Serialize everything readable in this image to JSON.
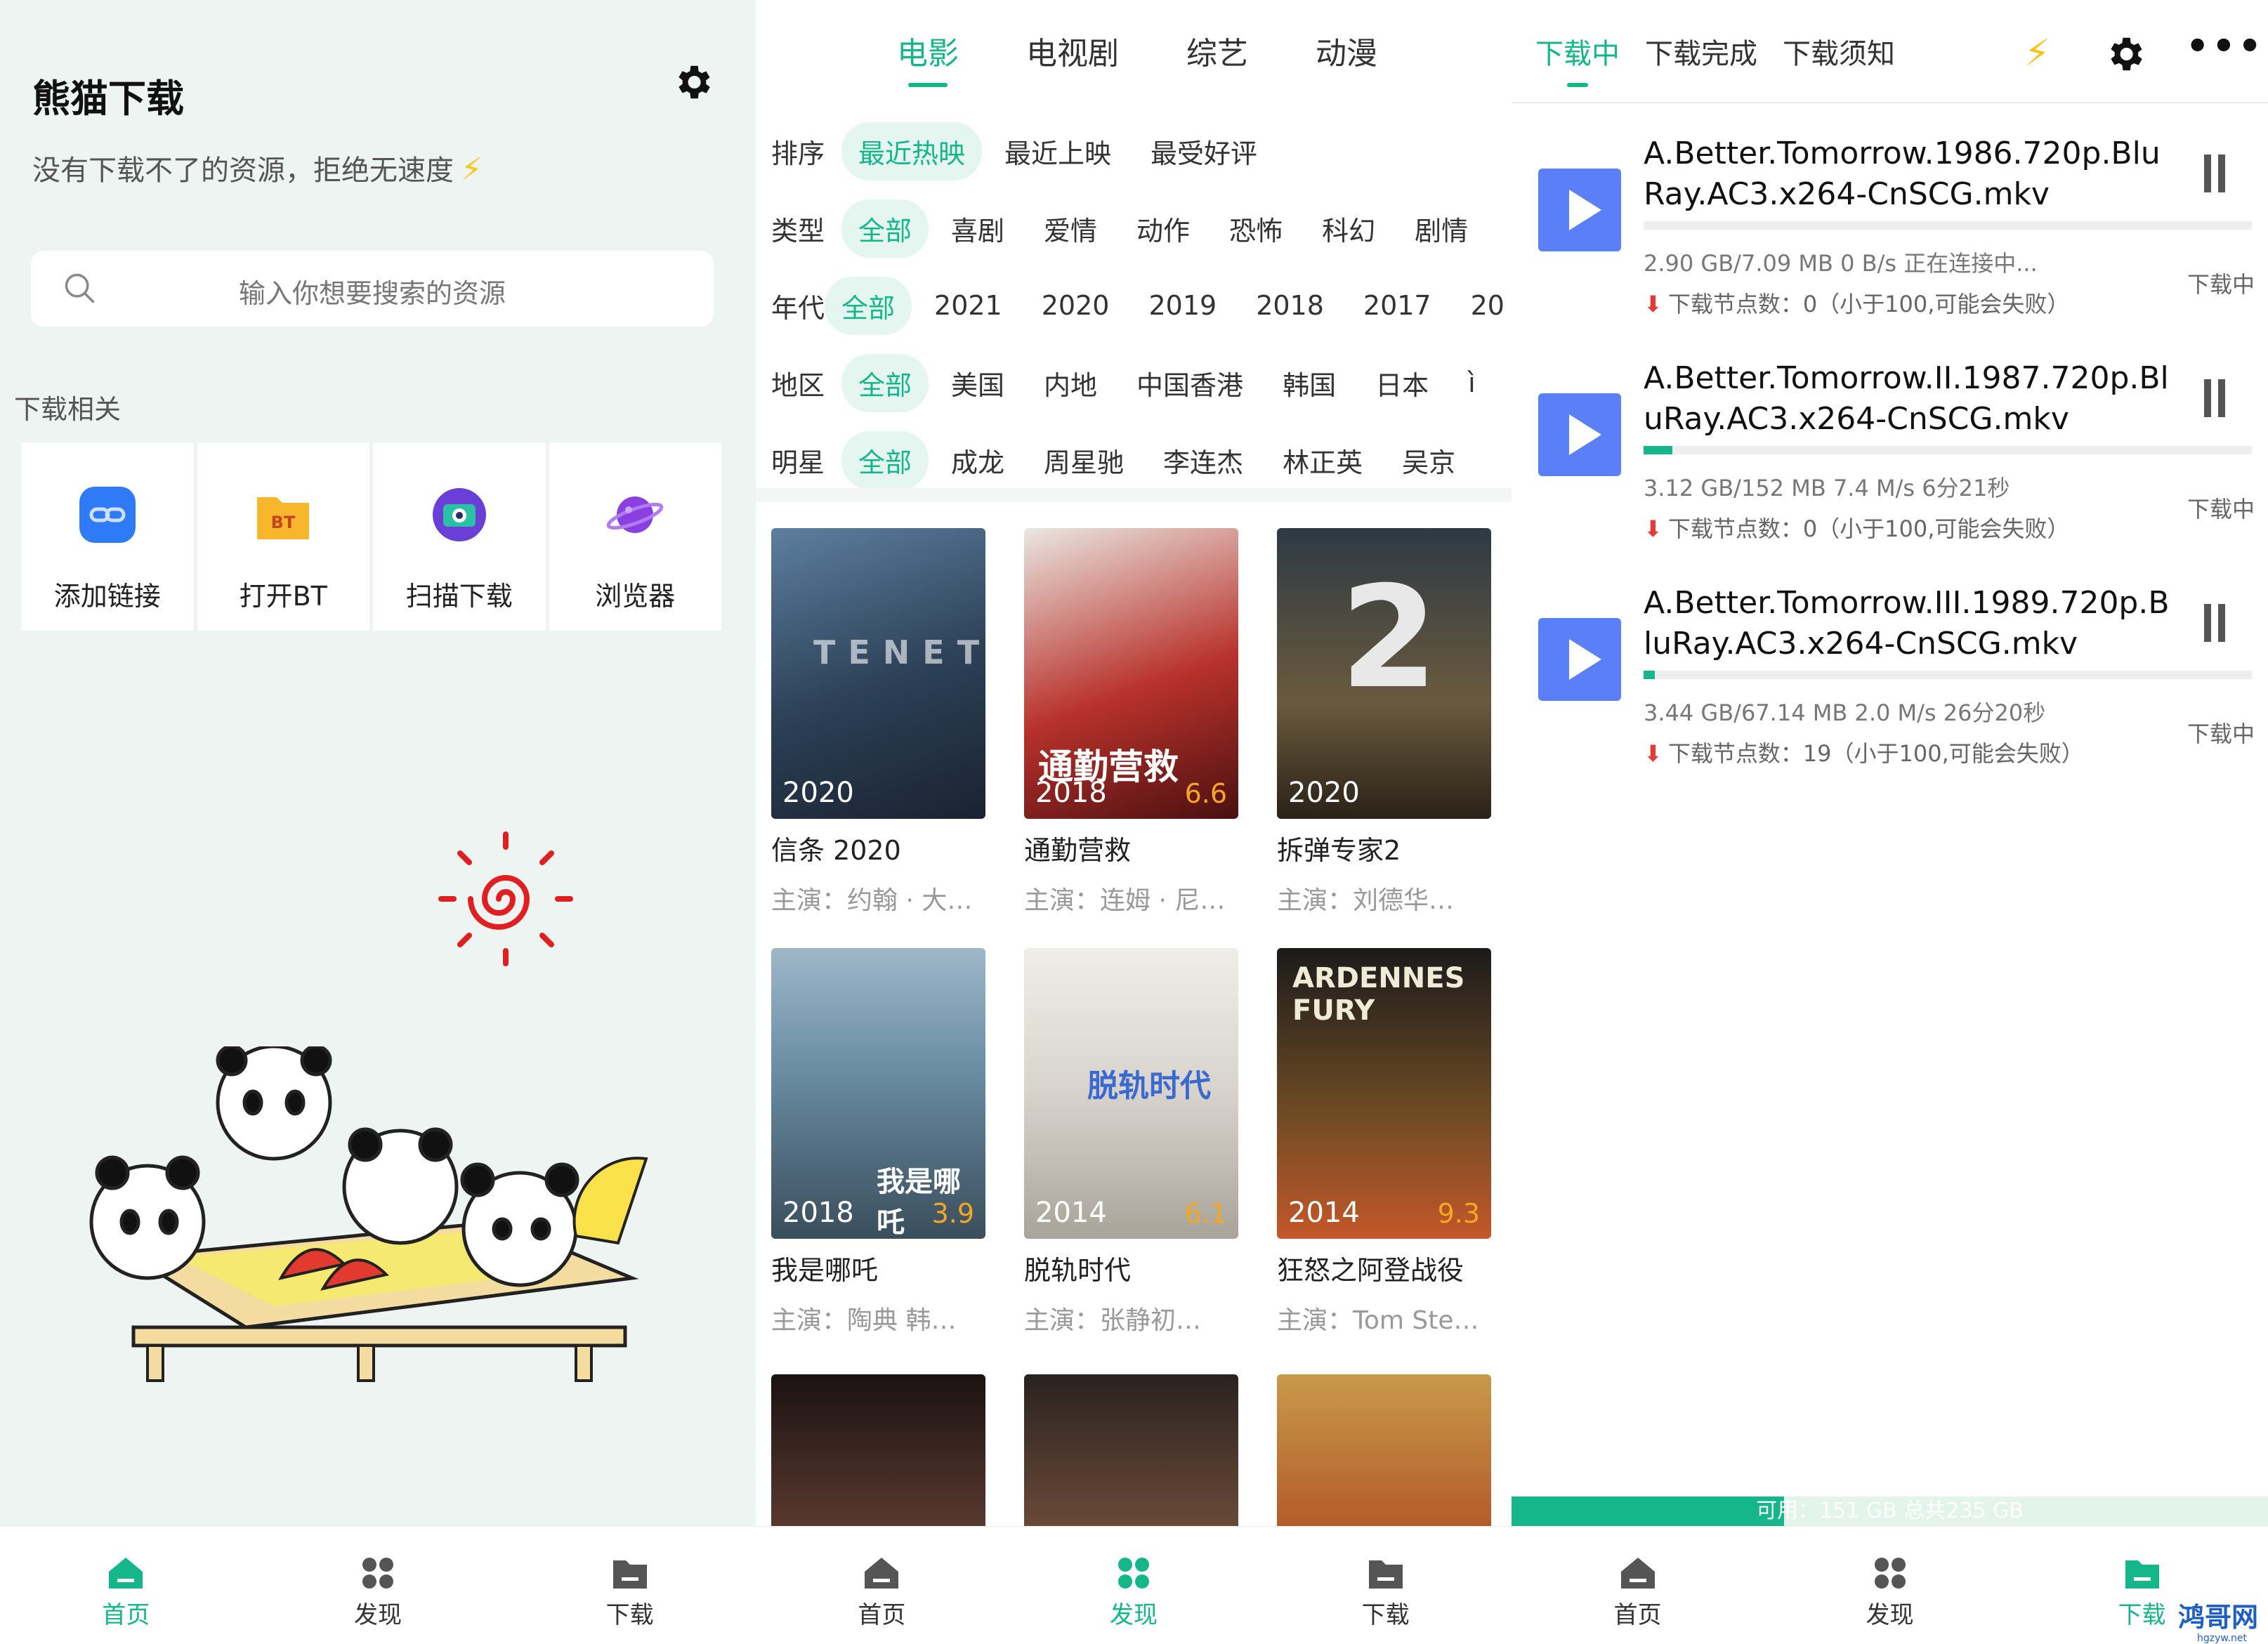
{
  "home": {
    "title": "熊猫下载",
    "subtitle": "没有下载不了的资源，拒绝无速度",
    "search_placeholder": "输入你想要搜索的资源",
    "section_label": "下载相关",
    "tools": [
      {
        "label": "添加链接",
        "icon": "link-icon",
        "color": "#2f7bf5"
      },
      {
        "label": "打开BT",
        "icon": "bt-folder-icon",
        "color": "#f7b62c"
      },
      {
        "label": "扫描下载",
        "icon": "scan-camera-icon",
        "color": "#6a3fd8"
      },
      {
        "label": "浏览器",
        "icon": "planet-icon",
        "color": "#8a3fe0"
      }
    ],
    "illustration_text": "BT"
  },
  "nav": {
    "home": "首页",
    "discover": "发现",
    "download": "下载"
  },
  "discover": {
    "tabs": [
      "电影",
      "电视剧",
      "综艺",
      "动漫"
    ],
    "active_tab": 0,
    "filters": [
      {
        "key": "排序",
        "options": [
          "最近热映",
          "最近上映",
          "最受好评"
        ],
        "selected": 0
      },
      {
        "key": "类型",
        "options": [
          "全部",
          "喜剧",
          "爱情",
          "动作",
          "恐怖",
          "科幻",
          "剧情"
        ],
        "selected": 0
      },
      {
        "key": "年代",
        "options": [
          "全部",
          "2021",
          "2020",
          "2019",
          "2018",
          "2017",
          "20"
        ],
        "selected": 0
      },
      {
        "key": "地区",
        "options": [
          "全部",
          "美国",
          "内地",
          "中国香港",
          "韩国",
          "日本",
          "ì"
        ],
        "selected": 0
      },
      {
        "key": "明星",
        "options": [
          "全部",
          "成龙",
          "周星驰",
          "李连杰",
          "林正英",
          "吴京"
        ],
        "selected": 0
      }
    ],
    "movies": [
      {
        "title": "信条 2020",
        "cast": "主演：约翰 · 大…",
        "year": "2020",
        "score": "",
        "art": "TENET",
        "bg": "linear-gradient(160deg,#5e7fa0 0%,#2b3f55 55%,#1a2230 100%)"
      },
      {
        "title": "通勤营救",
        "cast": "主演：连姆 · 尼…",
        "year": "2018",
        "score": "6.6",
        "art": "通勤营救",
        "bg": "linear-gradient(160deg,#eae7e2 0%,#b9322c 55%,#4a1010 100%)"
      },
      {
        "title": "拆弹专家2",
        "cast": "主演：刘德华…",
        "year": "2020",
        "score": "",
        "art": "2",
        "bg": "linear-gradient(180deg,#2d3a44 0%,#6a5a3e 60%,#2a2218 100%)"
      },
      {
        "title": "我是哪吒",
        "cast": "主演：陶典 韩…",
        "year": "2018",
        "score": "3.9",
        "art": "我是哪吒",
        "bg": "linear-gradient(180deg,#9fb7c8 0%,#6c8fa6 40%,#3a4e5c 100%)"
      },
      {
        "title": "脱轨时代",
        "cast": "主演：张静初…",
        "year": "2014",
        "score": "6.1",
        "art": "脱轨时代",
        "bg": "linear-gradient(180deg,#f0eee9 0%,#d7d3cc 50%,#a9a49a 100%)"
      },
      {
        "title": "狂怒之阿登战役",
        "cast": "主演：Tom Ste…",
        "year": "2014",
        "score": "9.3",
        "art": "ARDENNES FURY",
        "bg": "linear-gradient(180deg,#1b1b1b 0%,#6b4a24 55%,#c4582a 100%)"
      }
    ],
    "partial_posters": [
      {
        "bg": "linear-gradient(180deg,#1a1212 0%,#5a3a30 100%)"
      },
      {
        "bg": "linear-gradient(180deg,#2a2320 0%,#6a4a38 100%)"
      },
      {
        "bg": "linear-gradient(180deg,#c89a4a 0%,#b25a2a 100%)"
      }
    ]
  },
  "downloads": {
    "tabs": [
      "下载中",
      "下载完成",
      "下载须知"
    ],
    "active_tab": 0,
    "items": [
      {
        "name": "A.Better.Tomorrow.1986.720p.BluRay.AC3.x264-CnSCG.mkv",
        "info": "2.90 GB/7.09 MB 0 B/s 正在连接中...",
        "nodes": "下载节点数：0（小于100,可能会失败）",
        "state": "下载中",
        "progress": 0.0
      },
      {
        "name": "A.Better.Tomorrow.II.1987.720p.BluRay.AC3.x264-CnSCG.mkv",
        "info": "3.12 GB/152 MB 7.4 M/s 6分21秒",
        "nodes": "下载节点数：0（小于100,可能会失败）",
        "state": "下载中",
        "progress": 0.047
      },
      {
        "name": "A.Better.Tomorrow.III.1989.720p.BluRay.AC3.x264-CnSCG.mkv",
        "info": "3.44 GB/67.14 MB 2.0 M/s 26分20秒",
        "nodes": "下载节点数：19（小于100,可能会失败）",
        "state": "下载中",
        "progress": 0.019
      }
    ],
    "storage_text": "可用：151 GB 总共235 GB",
    "storage_used": 0.36
  },
  "watermark": {
    "main": "鸿哥网",
    "sub": "hgzyw.net"
  },
  "colors": {
    "accent": "#16b68b",
    "play": "#5b7ff6",
    "bolt": "#f5c518"
  }
}
